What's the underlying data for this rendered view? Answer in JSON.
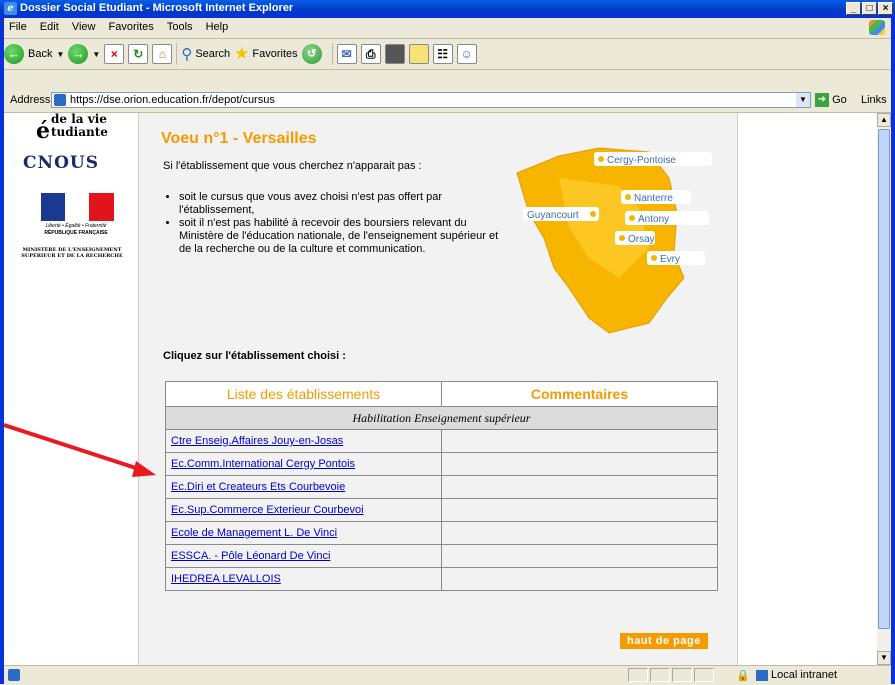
{
  "window": {
    "title": "Dossier Social Etudiant - Microsoft Internet Explorer",
    "buttons": {
      "minimize": "_",
      "maximize": "□",
      "close": "×"
    }
  },
  "menu": {
    "items": [
      "File",
      "Edit",
      "View",
      "Favorites",
      "Tools",
      "Help"
    ]
  },
  "toolbar": {
    "back_label": "Back",
    "search_label": "Search",
    "favorites_label": "Favorites"
  },
  "address": {
    "label": "Address",
    "url": "https://dse.orion.education.fr/depot/cursus",
    "go_label": "Go",
    "links_label": "Links"
  },
  "sidebar": {
    "logo_line1": "de la vie",
    "logo_letter": "é",
    "logo_line2": "tudiante",
    "cnous": "CNOUS",
    "motto": "Liberté • Égalité • Fraternité",
    "republique": "RÉPUBLIQUE FRANÇAISE",
    "ministere": "MINISTÈRE DE L'ENSEIGNEMENT SUPÉRIEUR ET DE LA RECHERCHE"
  },
  "main": {
    "heading": "Voeu n°1 - Versailles",
    "intro": "Si l'établissement que vous cherchez n'apparait pas :",
    "bullets": [
      "soit le cursus que vous avez choisi n'est pas offert par l'établissement,",
      "soit il n'est pas habilité à recevoir des boursiers relevant du Ministère de l'éducation nationale, de l'enseignement supérieur et de la recherche ou de la culture et communication."
    ],
    "choose_label": "Cliquez sur l'établissement choisi :",
    "back_to_top": "haut de page"
  },
  "map": {
    "cities": [
      "Cergy-Pontoise",
      "Nanterre",
      "Guyancourt",
      "Antony",
      "Orsay",
      "Evry"
    ],
    "colors": {
      "fill": "#f7b500",
      "label_bg": "#ffffff",
      "label_text": "#3b6fb6"
    }
  },
  "table": {
    "headers": [
      "Liste des établissements",
      "Commentaires"
    ],
    "section": "Habilitation Enseignement supérieur",
    "rows": [
      {
        "name": "Ctre Enseig.Affaires Jouy-en-Josas",
        "comment": ""
      },
      {
        "name": "Ec.Comm.International Cergy Pontois",
        "comment": ""
      },
      {
        "name": "Ec.Diri et Createurs Ets Courbevoie",
        "comment": ""
      },
      {
        "name": "Ec.Sup.Commerce Exterieur Courbevoi",
        "comment": ""
      },
      {
        "name": "Ecole de Management L. De Vinci",
        "comment": ""
      },
      {
        "name": "ESSCA. - Pôle Léonard De Vinci",
        "comment": ""
      },
      {
        "name": "IHEDREA LEVALLOIS",
        "comment": ""
      }
    ]
  },
  "status": {
    "zone": "Local intranet"
  },
  "colors": {
    "accent": "#f59b00",
    "link": "#0000cc",
    "arrow": "#e8191f",
    "titlebar": "#0a5ee8"
  }
}
